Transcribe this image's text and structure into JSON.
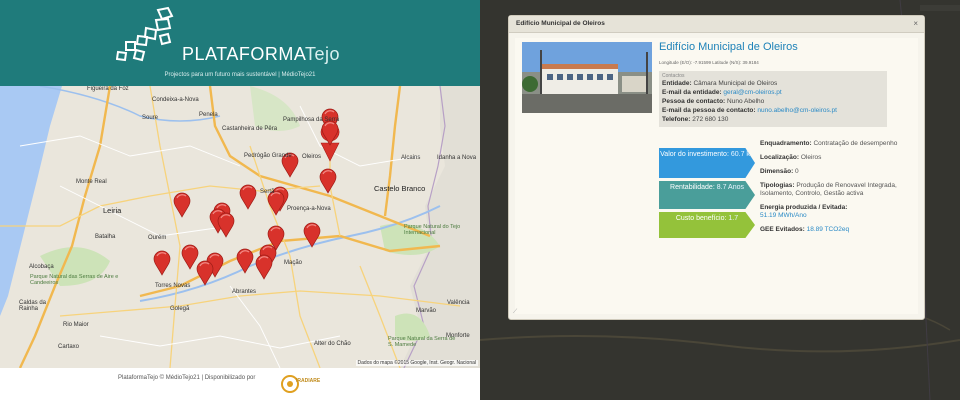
{
  "header": {
    "brand_bold": "PLATAFORMA",
    "brand_thin": "Tejo",
    "tagline": "Projectos para um futuro mais sustentável | MédioTejo21"
  },
  "map": {
    "places": [
      {
        "name": "Figueira da Foz",
        "big": false
      },
      {
        "name": "Condeixa-a-Nova",
        "big": false
      },
      {
        "name": "Soure",
        "big": false
      },
      {
        "name": "Penela",
        "big": false
      },
      {
        "name": "Castanheira de Pêra",
        "big": false
      },
      {
        "name": "Pampilhosa da Serra",
        "big": false
      },
      {
        "name": "Pedrógão Grande",
        "big": false
      },
      {
        "name": "Oleiros",
        "big": false
      },
      {
        "name": "Alcains",
        "big": false
      },
      {
        "name": "Idanha a Nova",
        "big": false
      },
      {
        "name": "Monte Real",
        "big": false
      },
      {
        "name": "Castelo Branco",
        "big": true
      },
      {
        "name": "Leiria",
        "big": true
      },
      {
        "name": "Sertã",
        "big": false
      },
      {
        "name": "Proença-a-Nova",
        "big": false
      },
      {
        "name": "Batalha",
        "big": false
      },
      {
        "name": "Ourém",
        "big": false
      },
      {
        "name": "Alcobaça",
        "big": false
      },
      {
        "name": "Mação",
        "big": false
      },
      {
        "name": "Caldas da Rainha",
        "big": false
      },
      {
        "name": "Torres Novas",
        "big": false
      },
      {
        "name": "Abrantes",
        "big": false
      },
      {
        "name": "Golegã",
        "big": false
      },
      {
        "name": "Rio Maior",
        "big": false
      },
      {
        "name": "Valência",
        "big": false
      },
      {
        "name": "Marvão",
        "big": false
      },
      {
        "name": "Cartaxo",
        "big": false
      },
      {
        "name": "Alter do Chão",
        "big": false
      },
      {
        "name": "Monforte",
        "big": false
      }
    ],
    "parks": [
      "Parque Natural das Serras de Aire e Candeeiros",
      "Parque Natural do Tejo Internacional",
      "Parque Natural da Serra de S. Mamede"
    ],
    "roads": [
      "A34",
      "A1",
      "A8",
      "A23",
      "N3",
      "E806",
      "E802",
      "N2",
      "N18",
      "A13"
    ],
    "copyright": "Dados do mapa ©2015 Google, Inst. Geogr. Nacional",
    "marker_color": "#d8322b"
  },
  "footer": {
    "text": "PlataformaTejo © MédioTejo21 | Disponibilizado por",
    "logo_text": "IRADIARE"
  },
  "modal": {
    "title": "Edifício Municipal de Oleiros",
    "close": "×",
    "entity_title": "Edifício Municipal de Oleiros",
    "coords": "Longitude (E/O): -7.91599   Latitude (N/S): 39.9184",
    "contacts_header": "Contactos",
    "contacts": [
      {
        "label": "Entidade:",
        "value": "Câmara Municipal de Oleiros",
        "link": false
      },
      {
        "label": "E-mail da entidade:",
        "value": "geral@cm-oleiros.pt",
        "link": true
      },
      {
        "label": "Pessoa de contacto:",
        "value": "Nuno Abelho",
        "link": false
      },
      {
        "label": "E-mail da pessoa de contacto:",
        "value": "nuno.abelho@cm-oleiros.pt",
        "link": true
      },
      {
        "label": "Telefone:",
        "value": "272 680 130",
        "link": false
      }
    ],
    "arrows": {
      "investment_label": "Valor do investimento:",
      "investment_value": "60.7 k€",
      "rent_label": "Rentabilidade:",
      "rent_value": "8.7 Anos",
      "cost_label": "Custo benefício:",
      "cost_value": "1.7"
    },
    "info": {
      "enquadramento_label": "Enquadramento:",
      "enquadramento_value": "Contratação de desempenho",
      "localizacao_label": "Localização:",
      "localizacao_value": "Oleiros",
      "dimensao_label": "Dimensão:",
      "dimensao_value": "0",
      "tipologias_label": "Tipologias:",
      "tipologias_value": "Produção de Renovavel Integrada, Isolamento, Controlo, Gestão activa",
      "energia_label": "Energia produzida / Evitada:",
      "energia_value": "51.19 MWh/Ano",
      "gee_label": "GEE Evitados:",
      "gee_value": "18.89 TCO2eq"
    },
    "colors": {
      "investment": "#3399dd",
      "rent": "#4a9e9a",
      "cost": "#94c23a",
      "link": "#2a8ac6"
    }
  }
}
